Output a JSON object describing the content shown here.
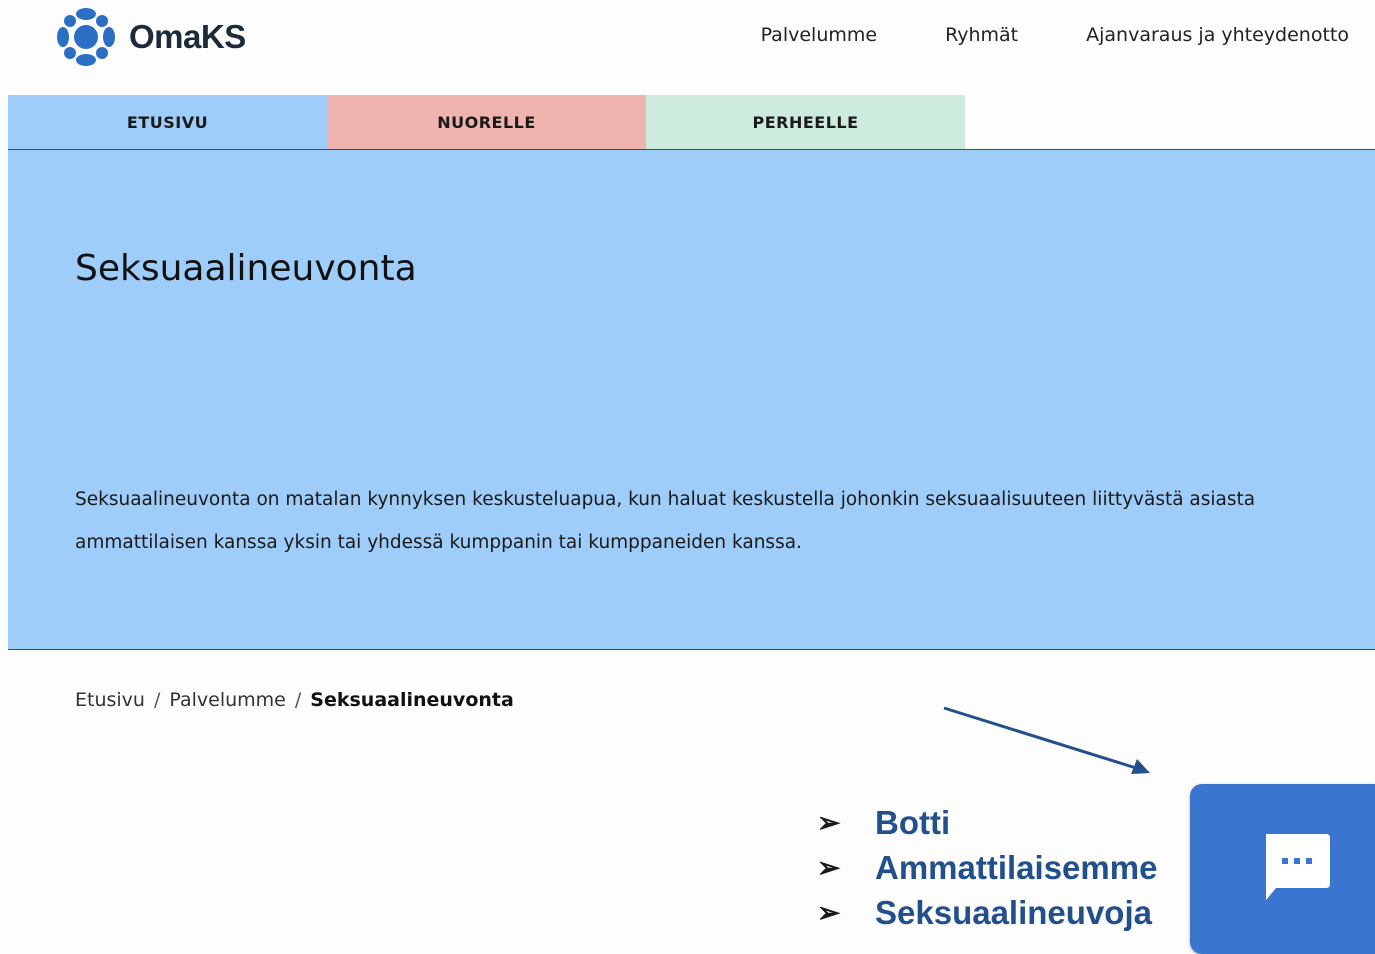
{
  "header": {
    "logo_text": "OmaKS",
    "nav": [
      "Palvelumme",
      "Ryhmät",
      "Ajanvaraus ja yhteydenotto"
    ]
  },
  "tabs": [
    "ETUSIVU",
    "NUORELLE",
    "PERHEELLE"
  ],
  "hero": {
    "title": "Seksuaalineuvonta",
    "text": "Seksuaalineuvonta on matalan kynnyksen keskusteluapua, kun haluat keskustella johonkin seksuaalisuuteen liittyvästä asiasta ammattilaisen kanssa yksin tai yhdessä kumppanin tai kumppaneiden kanssa."
  },
  "breadcrumb": {
    "items": [
      "Etusivu",
      "Palvelumme"
    ],
    "separator": "/",
    "current": "Seksuaalineuvonta"
  },
  "annotation": {
    "bullet": "➢",
    "items": [
      "Botti",
      "Ammattilaisemme",
      "Seksuaalineuvoja"
    ]
  },
  "chat_widget": {
    "icon": "chat-bubble-icon"
  },
  "colors": {
    "tab_etusivu": "#9ecdfa",
    "tab_nuorelle": "#efb4ad",
    "tab_perheelle": "#cdebdd",
    "hero_bg": "#9ecdfa",
    "annotation_text": "#22508d",
    "chat_button": "#3a76cf",
    "logo_blue": "#2a6fc4"
  }
}
